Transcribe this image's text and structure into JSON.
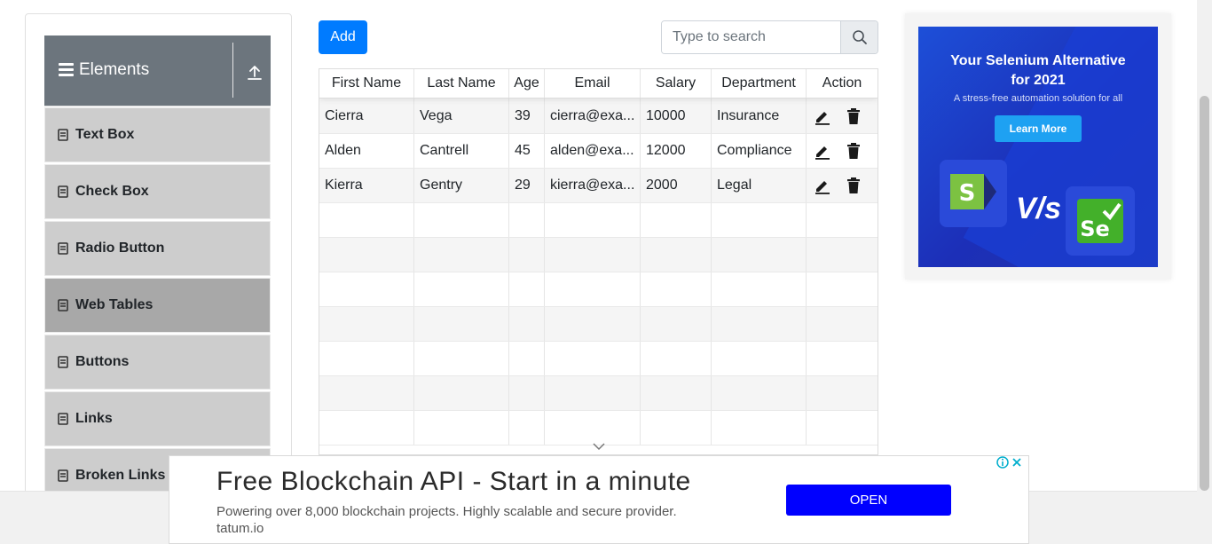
{
  "sidebar": {
    "group_title": "Elements",
    "items": [
      {
        "label": "Text Box"
      },
      {
        "label": "Check Box"
      },
      {
        "label": "Radio Button"
      },
      {
        "label": "Web Tables"
      },
      {
        "label": "Buttons"
      },
      {
        "label": "Links"
      },
      {
        "label": "Broken Links - "
      }
    ],
    "active_item": "Web Tables"
  },
  "toolbar": {
    "add_label": "Add",
    "search_placeholder": "Type to search",
    "search_value": ""
  },
  "table": {
    "columns": [
      "First Name",
      "Last Name",
      "Age",
      "Email",
      "Salary",
      "Department",
      "Action"
    ],
    "rows": [
      {
        "first": "Cierra",
        "last": "Vega",
        "age": "39",
        "email": "cierra@exa...",
        "salary": "10000",
        "dept": "Insurance"
      },
      {
        "first": "Alden",
        "last": "Cantrell",
        "age": "45",
        "email": "alden@exa...",
        "salary": "12000",
        "dept": "Compliance"
      },
      {
        "first": "Kierra",
        "last": "Gentry",
        "age": "29",
        "email": "kierra@exa...",
        "salary": "2000",
        "dept": "Legal"
      }
    ]
  },
  "ad_right": {
    "title_line1": "Your Selenium Alternative",
    "title_line2": "for 2021",
    "subtitle": "A stress-free automation solution for all",
    "cta": "Learn More",
    "vs": "V/s",
    "logo_left": "S",
    "logo_right": "Se"
  },
  "ad_bottom": {
    "headline": "Free Blockchain API - Start in a minute",
    "description": "Powering over 8,000 blockchain projects. Highly scalable and secure provider.",
    "domain": "tatum.io",
    "cta": "OPEN"
  },
  "colors": {
    "primary": "#007bff",
    "sidebar_header": "#6c757d",
    "menu_item": "#cdcdcd",
    "menu_item_active": "#a8a8a8",
    "ad_cta": "#0000ff"
  }
}
